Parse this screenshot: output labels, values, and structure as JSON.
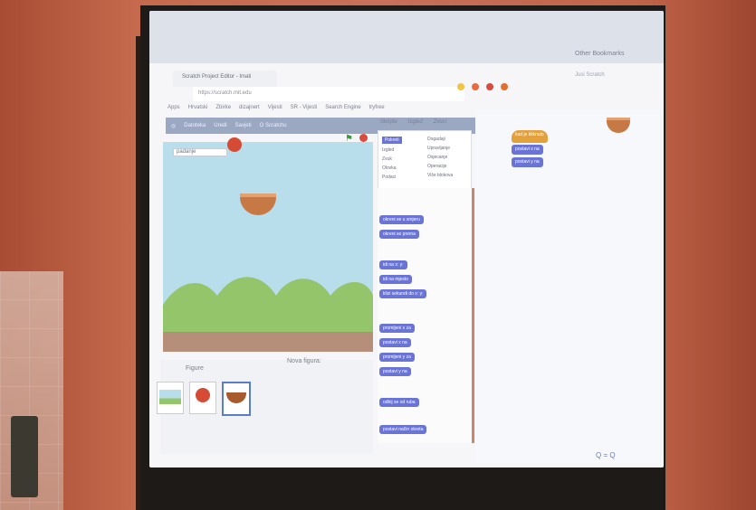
{
  "browser": {
    "tab_title": "Scratch Project Editor - Imati",
    "url": "https://scratch.mit.edu",
    "bookmarks_other": "Other Bookmarks",
    "user": "Jusi Scratch",
    "bookmarks": [
      "Apps",
      "Hrvatski",
      "Zbirke",
      "dizajnert",
      "Vijesti",
      "SR - Vijesti",
      "Search Engine",
      "tryfree"
    ]
  },
  "editor": {
    "toolbar": [
      "Datoteka",
      "Uredi",
      "Savjeti",
      "O Scratchu"
    ],
    "project_title": "padanje",
    "tabs": [
      "Skripte",
      "Izgled",
      "Zvuci"
    ],
    "categories": [
      "Pokreti",
      "Izgled",
      "Zvuk",
      "Olovka",
      "Podaci",
      "Dogadaji",
      "Upravljanje",
      "Osjecanje",
      "Operacije",
      "Više blokova"
    ],
    "blocks": [
      "okreni se u smjeru",
      "okreni se prema",
      "pokazivač miša",
      "idi na x: y:",
      "idi na mjesto",
      "klizi sekundi do x: y:",
      "promijeni x za",
      "postavi x na",
      "promijeni y za",
      "postavi y na",
      "odbij se od ruba",
      "postavi način okreta"
    ],
    "workspace_blocks": [
      "kad je kliknuto",
      "postavi x na",
      "postavi y na"
    ],
    "sprites_label": "Figure",
    "new_figure": "Nova figura:",
    "sprites": [
      "Pozornica",
      "Jabuka",
      "Zdjela"
    ],
    "zoom": "Q = Q"
  },
  "colors": {
    "stage_sky": "#b8ddeb",
    "hills": "#95c56a",
    "ground": "#b58f79",
    "apple": "#d54b35",
    "bowl": "#c77945",
    "blocks_blue": "#6a74d4",
    "blocks_purple": "#8a58c9",
    "hat_block": "#e2a13c"
  }
}
